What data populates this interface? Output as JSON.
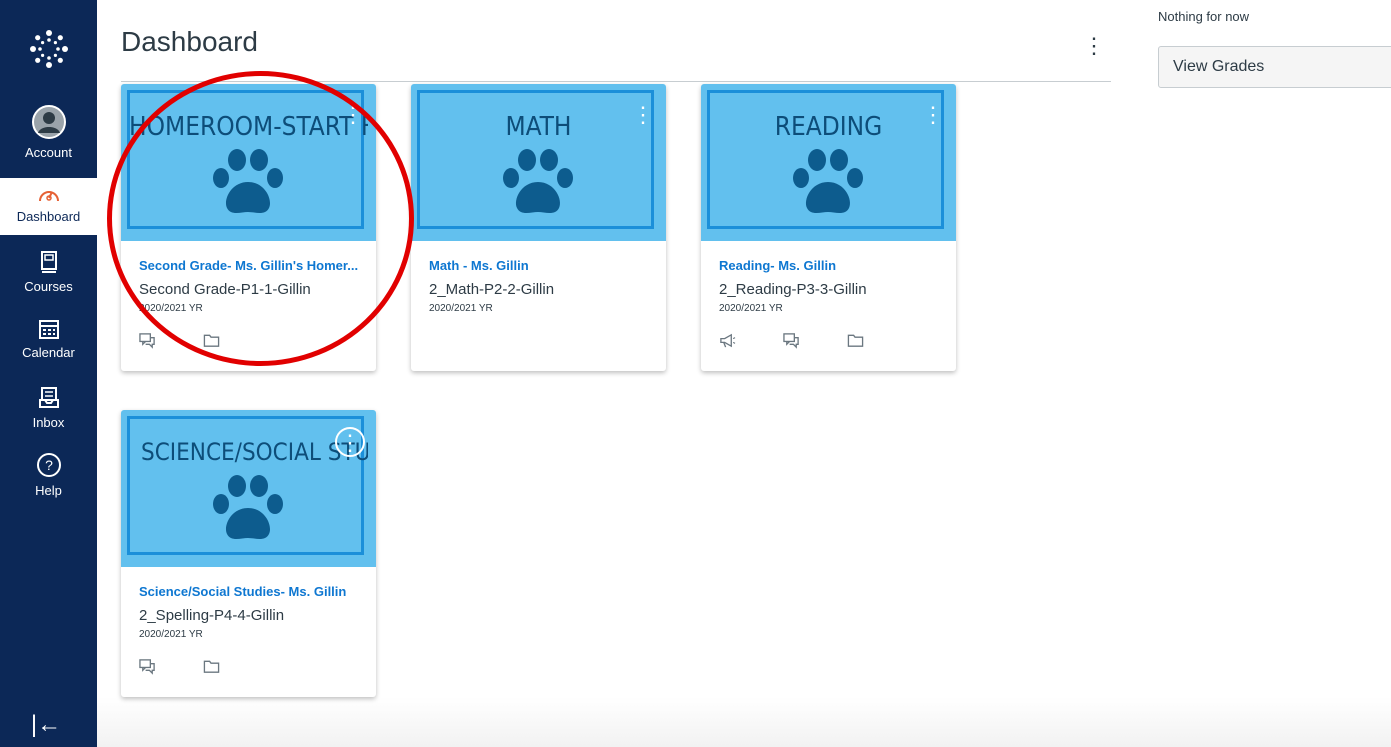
{
  "nav": {
    "items": [
      {
        "label": "Account",
        "icon": "account-avatar-icon"
      },
      {
        "label": "Dashboard",
        "icon": "dashboard-gauge-icon"
      },
      {
        "label": "Courses",
        "icon": "courses-book-icon"
      },
      {
        "label": "Calendar",
        "icon": "calendar-icon"
      },
      {
        "label": "Inbox",
        "icon": "inbox-icon"
      },
      {
        "label": "Help",
        "icon": "help-question-icon"
      }
    ],
    "collapse_icon": "collapse-nav-icon",
    "collapse_glyph": "|←"
  },
  "header": {
    "title": "Dashboard",
    "options_glyph": "⋮"
  },
  "right_column": {
    "todo_text": "Nothing for now",
    "view_grades_label": "View Grades"
  },
  "colors": {
    "nav_bg": "#0c2857",
    "active_accent": "#e66135",
    "card_hero": "#62c0ee",
    "card_link": "#0e77d1",
    "annotation": "#e10000"
  },
  "cards": [
    {
      "hero_title": "Homeroom-Start Here",
      "link": "Second Grade- Ms. Gillin's Homer...",
      "code": "Second Grade-P1-1-Gillin",
      "term": "2020/2021 YR",
      "actions": [
        "discussions-icon",
        "files-folder-icon"
      ]
    },
    {
      "hero_title": "Math",
      "link": "Math - Ms. Gillin",
      "code": "2_Math-P2-2-Gillin",
      "term": "2020/2021 YR",
      "actions": []
    },
    {
      "hero_title": "Reading",
      "link": "Reading- Ms. Gillin",
      "code": "2_Reading-P3-3-Gillin",
      "term": "2020/2021 YR",
      "actions": [
        "announcements-megaphone-icon",
        "discussions-icon",
        "files-folder-icon"
      ]
    },
    {
      "hero_title": "Science/Social Studies",
      "link": "Science/Social Studies- Ms. Gillin",
      "code": "2_Spelling-P4-4-Gillin",
      "term": "2020/2021 YR",
      "actions": [
        "discussions-icon",
        "files-folder-icon"
      ]
    }
  ]
}
